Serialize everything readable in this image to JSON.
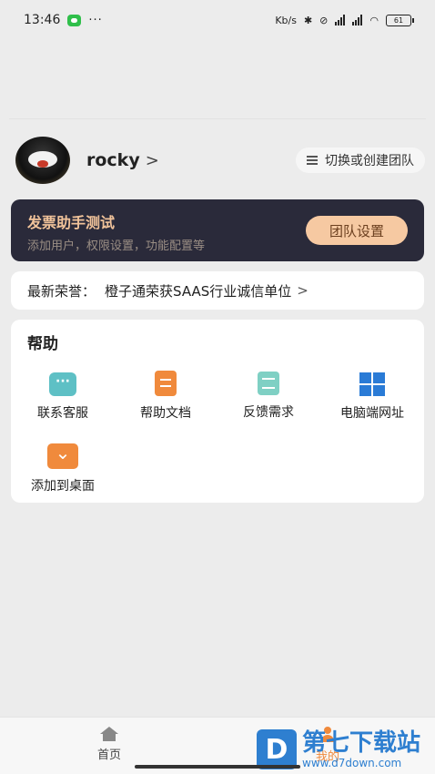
{
  "status_bar": {
    "time": "13:46",
    "dots": "···",
    "network_label": "Kb/s",
    "battery": "61"
  },
  "profile": {
    "username": "rocky",
    "arrow": ">",
    "switch_team_label": "切换或创建团队"
  },
  "team_card": {
    "name": "发票助手测试",
    "description": "添加用户，权限设置，功能配置等",
    "settings_label": "团队设置"
  },
  "honor": {
    "prefix": "最新荣誉：",
    "text": "橙子通荣获SAAS行业诚信单位",
    "arrow": ">"
  },
  "help": {
    "title": "帮助",
    "items": [
      {
        "label": "联系客服",
        "icon": "chat-icon"
      },
      {
        "label": "帮助文档",
        "icon": "document-icon"
      },
      {
        "label": "反馈需求",
        "icon": "feedback-icon"
      },
      {
        "label": "电脑端网址",
        "icon": "windows-icon"
      },
      {
        "label": "添加到桌面",
        "icon": "download-icon"
      }
    ]
  },
  "tabbar": {
    "home_label": "首页",
    "mine_label": "我的"
  },
  "watermark": {
    "logo": "D",
    "title": "第七下载站",
    "url": "www.d7down.com"
  },
  "colors": {
    "accent": "#f08a3c",
    "team_card_bg": "#2a2a3a",
    "team_name": "#f1c39a",
    "settings_btn_bg": "#f6c9a2",
    "watermark_blue": "#2e7fd0"
  }
}
